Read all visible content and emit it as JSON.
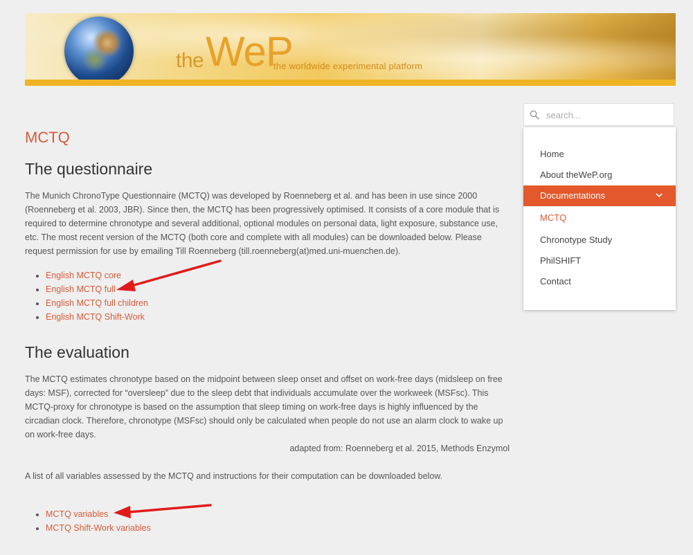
{
  "banner": {
    "logo_the": "the",
    "logo_wep": "WeP",
    "tagline": "the worldwide experimental platform"
  },
  "page_title": "MCTQ",
  "questionnaire": {
    "heading": "The questionnaire",
    "paragraph": "The Munich ChronoType Questionnaire (MCTQ) was developed by Roenneberg et al. and has been in use since 2000 (Roenneberg et al. 2003, JBR). Since then, the MCTQ has been progressively optimised. It consists of a core module that is required to determine chronotype and several additional, optional modules on personal data, light exposure, substance use, etc. The most recent version of the MCTQ (both core and complete with all modules) can be downloaded below. Please request permission for use by emailing Till Roenneberg (till.roenneberg(at)med.uni-muenchen.de).",
    "links": [
      "English MCTQ core",
      "English MCTQ full",
      "English MCTQ full children",
      "English MCTQ Shift-Work"
    ]
  },
  "evaluation": {
    "heading": "The evaluation",
    "paragraph": "The MCTQ estimates chronotype based on the midpoint between sleep onset and offset on work-free days (midsleep on free days: MSF), corrected for “oversleep” due to the sleep debt that individuals accumulate over the workweek (MSFsc). This MCTQ-proxy for chronotype is based on the assumption that sleep timing on work-free days is highly influenced by the circadian clock. Therefore, chronotype (MSFsc) should only be calculated when people do not use an alarm clock to wake up on work-free days.",
    "citation": "adapted from: Roenneberg et al. 2015, Methods Enzymol",
    "variables_intro": "A list of all variables assessed by the MCTQ and instructions for their computation can be downloaded below.",
    "links": [
      "MCTQ variables",
      "MCTQ Shift-Work variables"
    ]
  },
  "sidebar": {
    "search_placeholder": "search...",
    "menu": [
      "Home",
      "About theWeP.org",
      "Documentations",
      "MCTQ",
      "Chronotype Study",
      "PhilSHIFT",
      "Contact"
    ]
  },
  "colors": {
    "accent": "#d75b3a",
    "active_menu_bg": "#e3582c",
    "arrow": "#e01b1b"
  }
}
